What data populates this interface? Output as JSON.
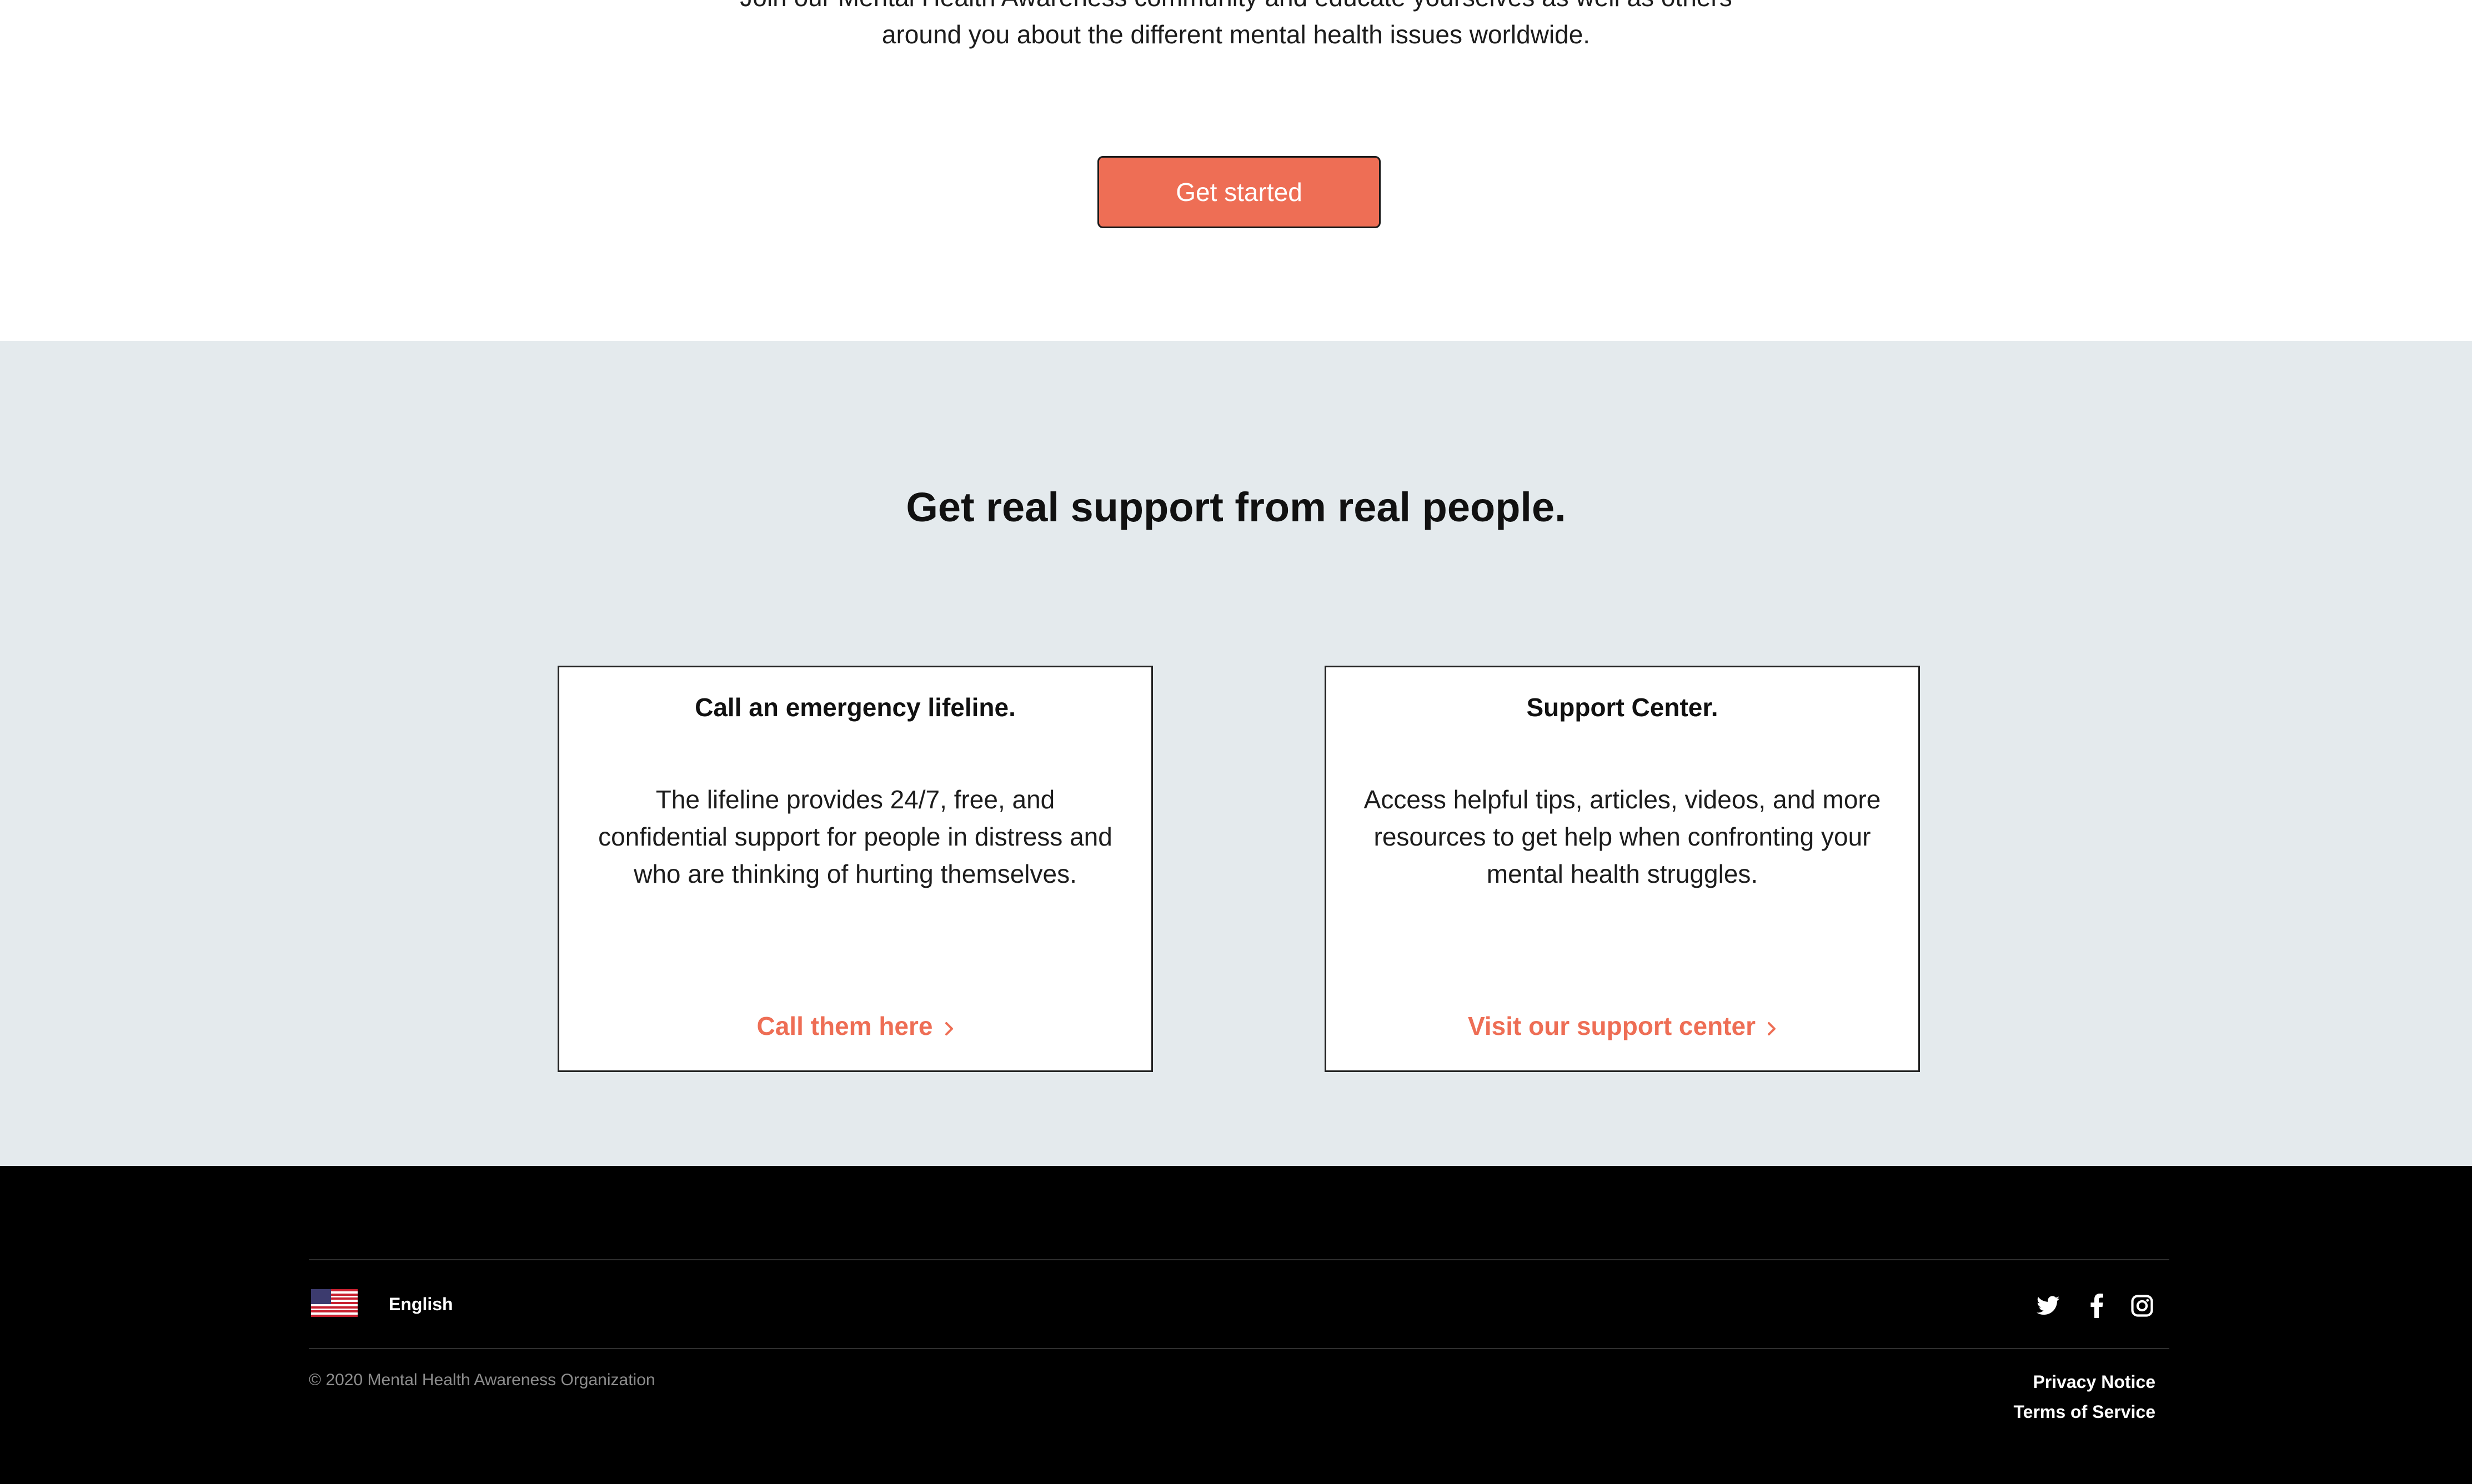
{
  "intro": {
    "line1": "Join our Mental Health Awareness community and educate yourselves as well as others",
    "line2": "around you about the different mental health issues worldwide.",
    "cta_label": "Get started"
  },
  "support": {
    "heading": "Get real support from real people.",
    "cards": [
      {
        "title": "Call an emergency lifeline.",
        "body": "The lifeline provides 24/7, free, and confidential support for people in distress and who are thinking of hurting themselves.",
        "link_label": "Call them here",
        "link_icon": "chevron-right-icon"
      },
      {
        "title": "Support Center.",
        "body": "Access helpful tips, articles, videos, and more resources to get help when confronting your mental health struggles.",
        "link_label": "Visit our support center",
        "link_icon": "chevron-right-icon"
      }
    ]
  },
  "footer": {
    "language": {
      "label": "English",
      "icon": "us-flag-icon"
    },
    "socials": [
      "twitter-icon",
      "facebook-icon",
      "instagram-icon"
    ],
    "copyright": "© 2020 Mental Health Awareness Organization",
    "links": [
      "Privacy Notice",
      "Terms of Service"
    ]
  },
  "colors": {
    "accent": "#ee6e55",
    "section_bg": "#e4eaed",
    "footer_bg": "#000000",
    "muted_text": "#8c8c8c"
  }
}
